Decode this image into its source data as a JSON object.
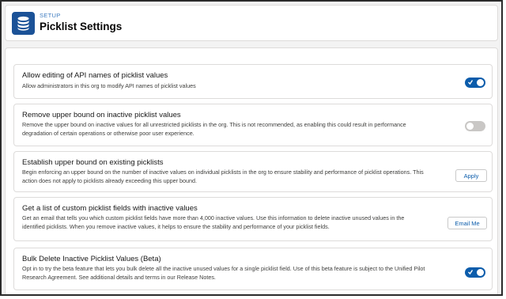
{
  "header": {
    "section": "SETUP",
    "title": "Picklist Settings",
    "icon": "database-icon"
  },
  "settings": [
    {
      "title": "Allow editing of API names of picklist values",
      "description": "Allow administrators in this org to modify API names of picklist values",
      "control": "toggle",
      "state": "on"
    },
    {
      "title": "Remove upper bound on inactive picklist values",
      "description_lines": [
        "Remove the upper bound on inactive values for all unrestricted picklists in the org. This is not recommended, as enabling this could result in performance",
        "degradation of certain operations or otherwise poor user experience."
      ],
      "control": "toggle",
      "state": "off"
    },
    {
      "title": "Establish upper bound on existing picklists",
      "description_lines": [
        "Begin enforcing an upper bound on the number of inactive values on individual picklists in the org to ensure stability and performance of picklist operations. This",
        "action does not apply to picklists already exceeding this upper bound."
      ],
      "control": "button",
      "button_label": "Apply"
    },
    {
      "title": "Get a list of custom picklist fields with inactive values",
      "description_lines": [
        "Get an email that tells you which custom picklist fields have more than 4,000 inactive values. Use this information to delete inactive unused values in the",
        "identified picklists. When you remove inactive values, it helps to ensure the stability and performance of your picklist fields."
      ],
      "control": "button",
      "button_label": "Email Me"
    },
    {
      "title": "Bulk Delete Inactive Picklist Values (Beta)",
      "description_lines": [
        "Opt in to try the beta feature that lets you bulk delete all the inactive unused values for a single picklist field. Use of this beta feature is subject to the Unified Pilot",
        "Research Agreement. See additional details and terms in our Release Notes."
      ],
      "control": "toggle",
      "state": "on"
    }
  ],
  "colors": {
    "brand": "#0b5cab",
    "icon_bg": "#1b5297",
    "toggle_off": "#c9c7c5",
    "page_bg": "#f3f3f3"
  }
}
